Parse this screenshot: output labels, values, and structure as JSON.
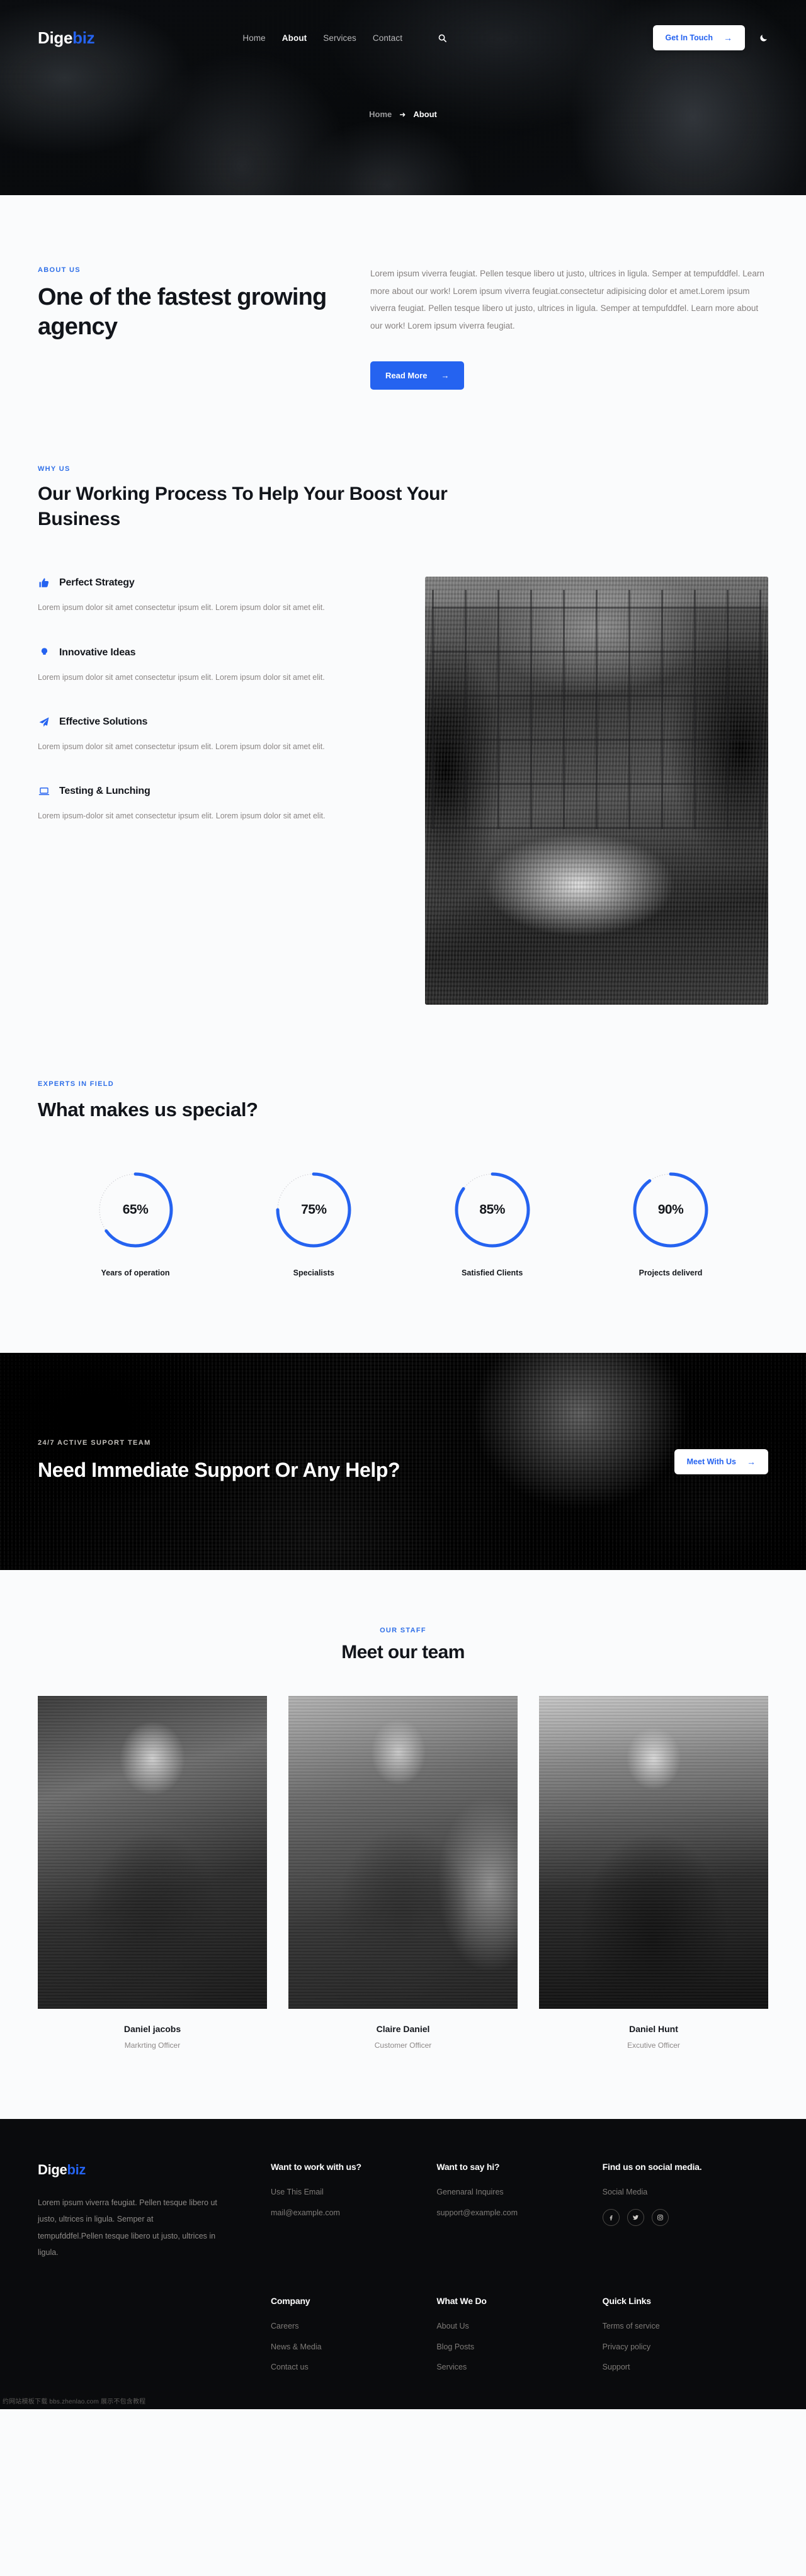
{
  "header": {
    "logo_main": "Dige",
    "logo_accent": "biz",
    "nav": [
      {
        "label": "Home",
        "active": false
      },
      {
        "label": "About",
        "active": true
      },
      {
        "label": "Services",
        "active": false
      },
      {
        "label": "Contact",
        "active": false
      }
    ],
    "search_icon": "search-icon",
    "cta_label": "Get In Touch",
    "cta_arrow": "→",
    "theme_toggle_icon": "moon-icon",
    "breadcrumb": {
      "home": "Home",
      "separator": "➜",
      "current": "About"
    }
  },
  "about": {
    "eyebrow": "ABOUT US",
    "title": "One of the fastest growing agency",
    "paragraph": "Lorem ipsum viverra feugiat. Pellen tesque libero ut justo, ultrices in ligula. Semper at tempufddfel. Learn more about our work! Lorem ipsum viverra feugiat.consectetur adipisicing dolor et amet.Lorem ipsum viverra feugiat. Pellen tesque libero ut justo, ultrices in ligula. Semper at tempufddfel. Learn more about our work! Lorem ipsum viverra feugiat.",
    "button_label": "Read More",
    "button_arrow": "→"
  },
  "why": {
    "eyebrow": "WHY US",
    "title": "Our Working Process To Help Your Boost Your Business",
    "features": [
      {
        "icon": "thumbs-up-icon",
        "title": "Perfect Strategy",
        "text": "Lorem ipsum dolor sit amet consectetur ipsum elit. Lorem ipsum dolor sit amet elit."
      },
      {
        "icon": "lightbulb-icon",
        "title": "Innovative Ideas",
        "text": "Lorem ipsum dolor sit amet consectetur ipsum elit. Lorem ipsum dolor sit amet elit."
      },
      {
        "icon": "paper-plane-icon",
        "title": "Effective Solutions",
        "text": "Lorem ipsum dolor sit amet consectetur ipsum elit. Lorem ipsum dolor sit amet elit."
      },
      {
        "icon": "laptop-icon",
        "title": "Testing & Lunching",
        "text": "Lorem ipsum-dolor sit amet consectetur ipsum elit. Lorem ipsum dolor sit amet elit."
      }
    ],
    "image_alt": "team-meeting-photo"
  },
  "stats": {
    "eyebrow": "EXPERTS IN FIELD",
    "title": "What makes us special?",
    "accent_color": "#2563f0",
    "track_color": "#d8d8dc",
    "items": [
      {
        "value": 65,
        "display": "65%",
        "label": "Years of operation"
      },
      {
        "value": 75,
        "display": "75%",
        "label": "Specialists"
      },
      {
        "value": 85,
        "display": "85%",
        "label": "Satisfied Clients"
      },
      {
        "value": 90,
        "display": "90%",
        "label": "Projects deliverd"
      }
    ]
  },
  "cta": {
    "eyebrow": "24/7 ACTIVE SUPORT TEAM",
    "title": "Need Immediate Support Or Any Help?",
    "button_label": "Meet With Us",
    "button_arrow": "→"
  },
  "team": {
    "eyebrow": "OUR STAFF",
    "title": "Meet our team",
    "members": [
      {
        "name": "Daniel jacobs",
        "role": "Markrting Officer"
      },
      {
        "name": "Claire Daniel",
        "role": "Customer Officer"
      },
      {
        "name": "Daniel Hunt",
        "role": "Excutive Officer"
      }
    ]
  },
  "footer": {
    "logo_main": "Dige",
    "logo_accent": "biz",
    "description": "Lorem ipsum viverra feugiat. Pellen tesque libero ut justo, ultrices in ligula. Semper at tempufddfel.Pellen tesque libero ut justo, ultrices in ligula.",
    "columns_top": [
      {
        "heading": "Want to work with us?",
        "items": [
          "Use This Email",
          "mail@example.com"
        ]
      },
      {
        "heading": "Want to say hi?",
        "items": [
          "Genenaral Inquires",
          "support@example.com"
        ]
      },
      {
        "heading": "Find us on social media.",
        "items": [
          "Social Media"
        ],
        "socials": [
          "facebook-icon",
          "twitter-icon",
          "instagram-icon"
        ]
      }
    ],
    "columns_bottom": [
      {
        "heading": "Company",
        "items": [
          "Careers",
          "News & Media",
          "Contact us"
        ]
      },
      {
        "heading": "What We Do",
        "items": [
          "About Us",
          "Blog Posts",
          "Services"
        ]
      },
      {
        "heading": "Quick Links",
        "items": [
          "Terms of service",
          "Privacy policy",
          "Support"
        ]
      }
    ]
  },
  "watermark": "约网站模板下载 bbs.zhenlao.com 展示不包含教程"
}
